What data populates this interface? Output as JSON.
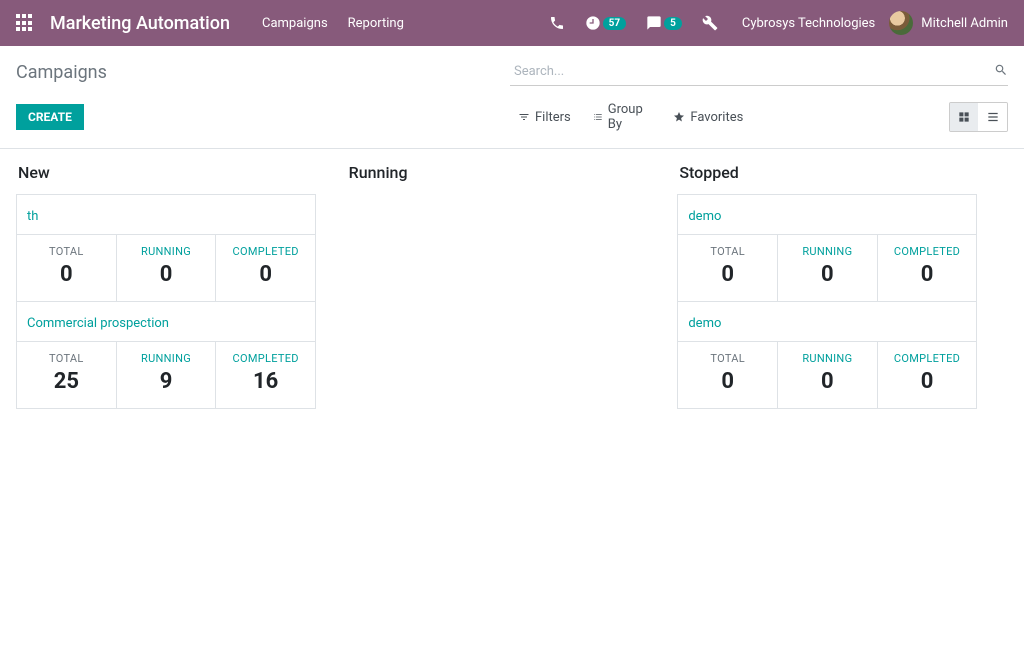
{
  "header": {
    "brand": "Marketing Automation",
    "nav": {
      "campaigns": "Campaigns",
      "reporting": "Reporting"
    },
    "badge_clock": "57",
    "badge_msg": "5",
    "company": "Cybrosys Technologies",
    "user": "Mitchell Admin"
  },
  "control": {
    "breadcrumb": "Campaigns",
    "search_placeholder": "Search...",
    "create": "CREATE",
    "filters": "Filters",
    "group_by": "Group By",
    "favorites": "Favorites"
  },
  "labels": {
    "total": "TOTAL",
    "running": "RUNNING",
    "completed": "COMPLETED"
  },
  "columns": {
    "new": {
      "title": "New",
      "cards": [
        {
          "name": "th",
          "total": "0",
          "running": "0",
          "completed": "0"
        },
        {
          "name": "Commercial prospection",
          "total": "25",
          "running": "9",
          "completed": "16"
        }
      ]
    },
    "running": {
      "title": "Running"
    },
    "stopped": {
      "title": "Stopped",
      "cards": [
        {
          "name": "demo",
          "total": "0",
          "running": "0",
          "completed": "0"
        },
        {
          "name": "demo",
          "total": "0",
          "running": "0",
          "completed": "0"
        }
      ]
    }
  }
}
